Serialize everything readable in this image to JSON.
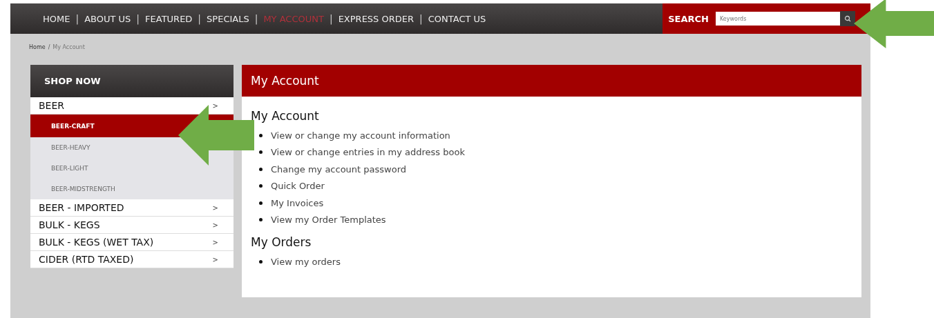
{
  "nav": {
    "items": [
      {
        "label": "HOME",
        "selected": false
      },
      {
        "label": "ABOUT US",
        "selected": false
      },
      {
        "label": "FEATURED",
        "selected": false
      },
      {
        "label": "SPECIALS",
        "selected": false
      },
      {
        "label": "MY ACCOUNT",
        "selected": true
      },
      {
        "label": "EXPRESS ORDER",
        "selected": false
      },
      {
        "label": "CONTACT US",
        "selected": false
      }
    ],
    "separator": "|",
    "search": {
      "label": "SEARCH",
      "placeholder": "Keywords"
    }
  },
  "breadcrumb": {
    "separator": "/",
    "items": [
      "Home",
      "My Account"
    ]
  },
  "sidebar": {
    "title": "SHOP NOW",
    "items": [
      {
        "label": "BEER",
        "arrow": ">",
        "children": [
          {
            "label": "BEER-CRAFT",
            "selected": true
          },
          {
            "label": "BEER-HEAVY",
            "selected": false
          },
          {
            "label": "BEER-LIGHT",
            "selected": false
          },
          {
            "label": "BEER-MIDSTRENGTH",
            "selected": false
          }
        ]
      },
      {
        "label": "BEER - IMPORTED",
        "arrow": ">"
      },
      {
        "label": "BULK - KEGS",
        "arrow": ">"
      },
      {
        "label": "BULK - KEGS (WET TAX)",
        "arrow": ">"
      },
      {
        "label": "CIDER (RTD TAXED)",
        "arrow": ">"
      }
    ]
  },
  "panel": {
    "title": "My Account",
    "sections": [
      {
        "heading": "My Account",
        "links": [
          "View or change my account information",
          "View or change entries in my address book",
          "Change my account password",
          "Quick Order",
          "My Invoices",
          "View my Order Templates"
        ]
      },
      {
        "heading": "My Orders",
        "links": [
          "View my orders"
        ]
      }
    ]
  }
}
